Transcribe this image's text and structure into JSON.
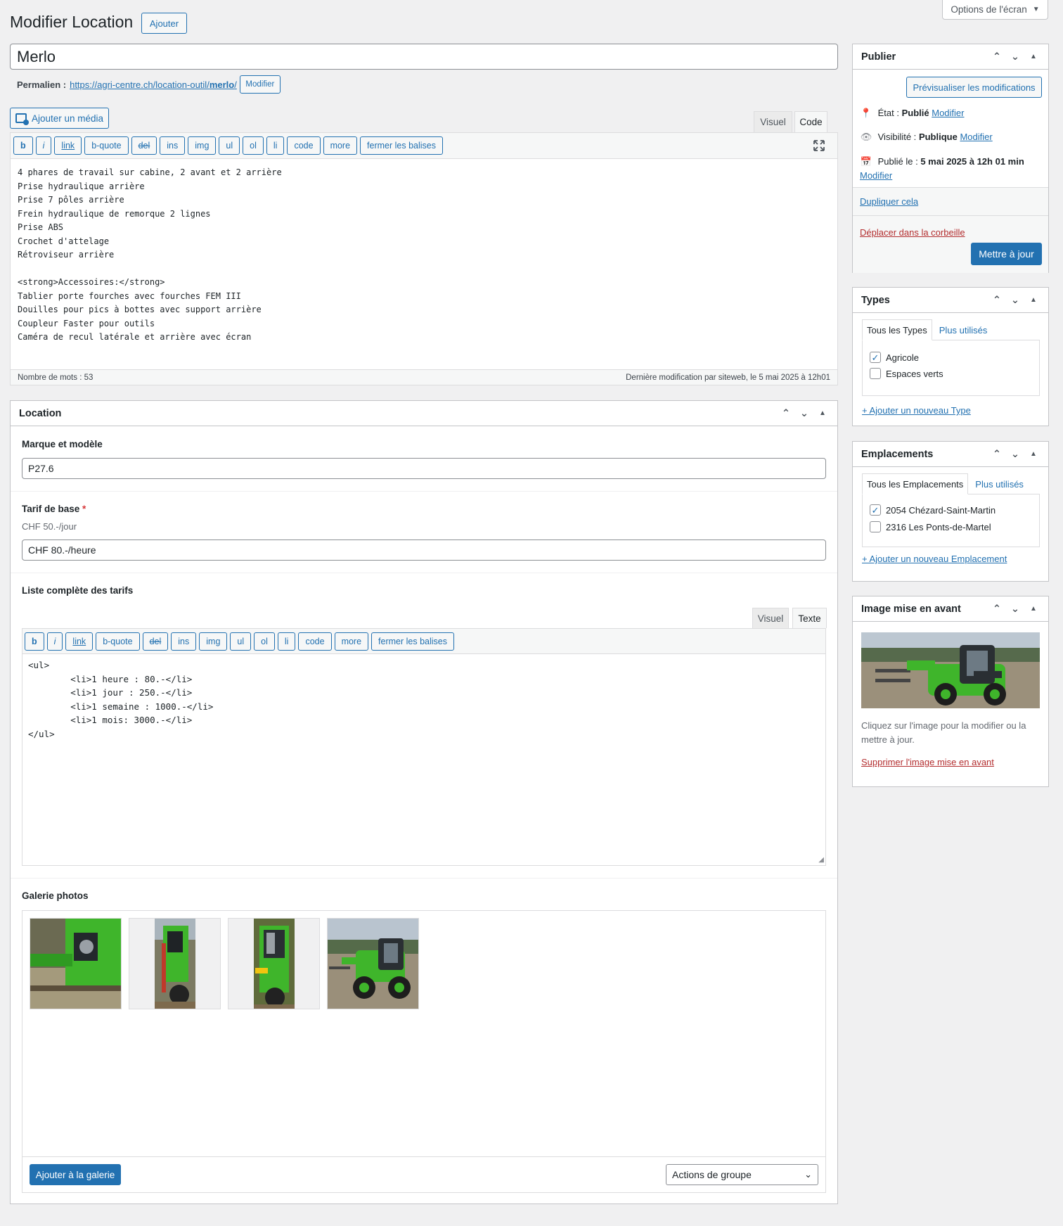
{
  "screen_options": {
    "label": "Options de l'écran"
  },
  "header": {
    "title": "Modifier Location",
    "add_label": "Ajouter"
  },
  "post_title": "Merlo",
  "permalink": {
    "label": "Permalien :",
    "url_prefix": "https://agri-centre.ch/location-outil/",
    "slug": "merlo",
    "edit_label": "Modifier"
  },
  "editor": {
    "add_media_label": "Ajouter un média",
    "tabs": [
      "Visuel",
      "Code"
    ],
    "active_tab": "Code",
    "quicktags": [
      "b",
      "i",
      "link",
      "b-quote",
      "del",
      "ins",
      "img",
      "ul",
      "ol",
      "li",
      "code",
      "more",
      "fermer les balises"
    ],
    "content": "4 phares de travail sur cabine, 2 avant et 2 arrière\nPrise hydraulique arrière\nPrise 7 pôles arrière\nFrein hydraulique de remorque 2 lignes\nPrise ABS\nCrochet d'attelage\nRétroviseur arrière\n\n<strong>Accessoires:</strong>\nTablier porte fourches avec fourches FEM III\nDouilles pour pics à bottes avec support arrière\nCoupleur Faster pour outils\nCaméra de recul latérale et arrière avec écran",
    "word_count": "Nombre de mots : 53",
    "last_modified": "Dernière modification par siteweb, le 5 mai 2025 à 12h01"
  },
  "location_box": {
    "title": "Location",
    "brand_label": "Marque et modèle",
    "brand_value": "P27.6",
    "base_rate_label": "Tarif de base",
    "required_mark": "*",
    "base_rate_hint": "CHF 50.-/jour",
    "base_rate_value": "CHF 80.-/heure",
    "full_rates_label": "Liste complète des tarifs",
    "full_rates_tabs": [
      "Visuel",
      "Texte"
    ],
    "full_rates_quicktags": [
      "b",
      "i",
      "link",
      "b-quote",
      "del",
      "ins",
      "img",
      "ul",
      "ol",
      "li",
      "code",
      "more",
      "fermer les balises"
    ],
    "full_rates_content": "<ul>\n        <li>1 heure : 80.-</li>\n        <li>1 jour : 250.-</li>\n        <li>1 semaine : 1000.-</li>\n        <li>1 mois: 3000.-</li>\n</ul>",
    "gallery_label": "Galerie photos",
    "gallery_add_label": "Ajouter à la galerie",
    "gallery_actions_label": "Actions de groupe"
  },
  "publish_box": {
    "title": "Publier",
    "preview_label": "Prévisualiser les modifications",
    "status_label": "État :",
    "status_value": "Publié",
    "visibility_label": "Visibilité :",
    "visibility_value": "Publique",
    "published_label": "Publié le :",
    "published_value": "5 mai 2025 à 12h 01 min",
    "edit_label": "Modifier",
    "duplicate_label": "Dupliquer cela",
    "trash_label": "Déplacer dans la corbeille",
    "update_label": "Mettre à jour"
  },
  "types_box": {
    "title": "Types",
    "tab_all": "Tous les Types",
    "tab_popular": "Plus utilisés",
    "items": [
      {
        "label": "Agricole",
        "checked": true
      },
      {
        "label": "Espaces verts",
        "checked": false
      }
    ],
    "add_new": "+ Ajouter un nouveau Type"
  },
  "locations_box": {
    "title": "Emplacements",
    "tab_all": "Tous les Emplacements",
    "tab_popular": "Plus utilisés",
    "items": [
      {
        "label": "2054 Chézard-Saint-Martin",
        "checked": true
      },
      {
        "label": "2316 Les Ponts-de-Martel",
        "checked": false
      }
    ],
    "add_new": "+ Ajouter un nouveau Emplacement"
  },
  "featured_box": {
    "title": "Image mise en avant",
    "hint": "Cliquez sur l'image pour la modifier ou la mettre à jour.",
    "remove_label": "Supprimer l'image mise en avant"
  },
  "colors": {
    "accent": "#2271b1",
    "danger": "#b32d2e",
    "machine_green": "#3fb52b"
  }
}
